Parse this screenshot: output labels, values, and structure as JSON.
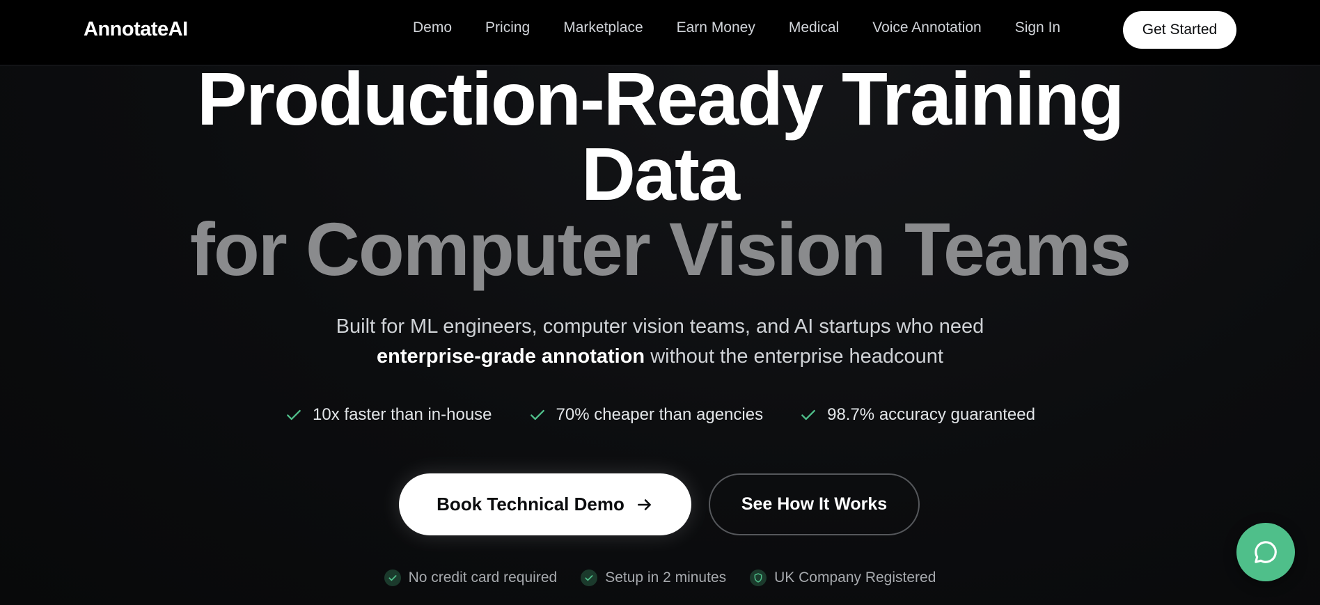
{
  "brand": {
    "logo_text": "AnnotateAI"
  },
  "nav": {
    "links": [
      {
        "label": "Demo"
      },
      {
        "label": "Pricing"
      },
      {
        "label": "Marketplace"
      },
      {
        "label": "Earn Money"
      },
      {
        "label": "Medical"
      },
      {
        "label": "Voice Annotation"
      },
      {
        "label": "Sign In"
      }
    ],
    "cta_label": "Get Started"
  },
  "hero": {
    "title_line1": "Production-Ready Training",
    "title_line2": "Data",
    "title_line3": "for Computer Vision Teams",
    "subtitle_part1": "Built for ML engineers, computer vision teams, and AI startups who need",
    "subtitle_bold": "enterprise-grade annotation",
    "subtitle_part2": " without the enterprise headcount",
    "features": [
      {
        "icon": "check-icon",
        "label": "10x faster than in-house"
      },
      {
        "icon": "check-icon",
        "label": "70% cheaper than agencies"
      },
      {
        "icon": "check-icon",
        "label": "98.7% accuracy guaranteed"
      }
    ],
    "primary_button": {
      "label": "Book Technical Demo",
      "icon": "arrow-right-icon"
    },
    "secondary_button": {
      "label": "See How It Works"
    },
    "trust_items": [
      {
        "icon": "check-circle-icon",
        "label": "No credit card required"
      },
      {
        "icon": "check-circle-icon",
        "label": "Setup in 2 minutes"
      },
      {
        "icon": "shield-icon",
        "label": "UK Company Registered"
      }
    ]
  },
  "chat": {
    "icon": "chat-bubble-icon"
  },
  "colors": {
    "accent_green": "#4fbf8a",
    "background": "#0b0c0e",
    "muted_title": "#8a8b8d"
  }
}
